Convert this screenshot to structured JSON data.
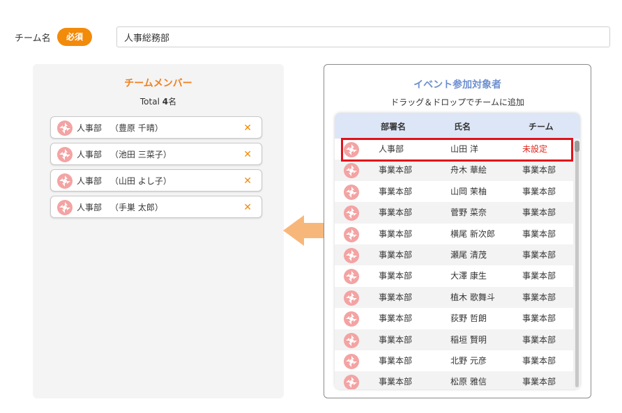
{
  "team_name": {
    "label": "チーム名",
    "required_badge": "必須",
    "value": "人事総務部"
  },
  "members_panel": {
    "title": "チームメンバー",
    "total_prefix": "Total ",
    "total_count": "4",
    "total_suffix": "名",
    "members": [
      {
        "dept": "人事部",
        "name": "（豊原 千晴）"
      },
      {
        "dept": "人事部",
        "name": "（池田 三菜子）"
      },
      {
        "dept": "人事部",
        "name": "（山田 よし子）"
      },
      {
        "dept": "人事部",
        "name": "（手巣 太郎）"
      }
    ],
    "remove_glyph": "✕"
  },
  "targets_panel": {
    "title": "イベント参加対象者",
    "hint": "ドラッグ＆ドロップでチームに追加",
    "columns": {
      "dept": "部署名",
      "name": "氏名",
      "team": "チーム"
    },
    "rows": [
      {
        "dept": "人事部",
        "name": "山田 洋",
        "team": "未設定"
      },
      {
        "dept": "事業本部",
        "name": "舟木 華絵",
        "team": "事業本部"
      },
      {
        "dept": "事業本部",
        "name": "山岡 茉柚",
        "team": "事業本部"
      },
      {
        "dept": "事業本部",
        "name": "菅野 菜奈",
        "team": "事業本部"
      },
      {
        "dept": "事業本部",
        "name": "横尾 新次郎",
        "team": "事業本部"
      },
      {
        "dept": "事業本部",
        "name": "瀬尾 清茂",
        "team": "事業本部"
      },
      {
        "dept": "事業本部",
        "name": "大澤 康生",
        "team": "事業本部"
      },
      {
        "dept": "事業本部",
        "name": "植木 歌舞斗",
        "team": "事業本部"
      },
      {
        "dept": "事業本部",
        "name": "荻野 哲朗",
        "team": "事業本部"
      },
      {
        "dept": "事業本部",
        "name": "稲垣 賢明",
        "team": "事業本部"
      },
      {
        "dept": "事業本部",
        "name": "北野 元彦",
        "team": "事業本部"
      },
      {
        "dept": "事業本部",
        "name": "松原 雅信",
        "team": "事業本部"
      }
    ]
  },
  "icons": {
    "avatar": "avatar-icon",
    "arrow": "arrow-left-icon",
    "remove": "close-icon"
  },
  "colors": {
    "accent_orange": "#f28a0a",
    "title_orange": "#f0801e",
    "title_blue": "#6d8fcf",
    "unset_red": "#e0261e",
    "highlight_red": "#e0121a",
    "header_blue": "#dde6f7",
    "arrow_orange": "#f8b77a",
    "avatar_pink": "#f4a3a3"
  }
}
